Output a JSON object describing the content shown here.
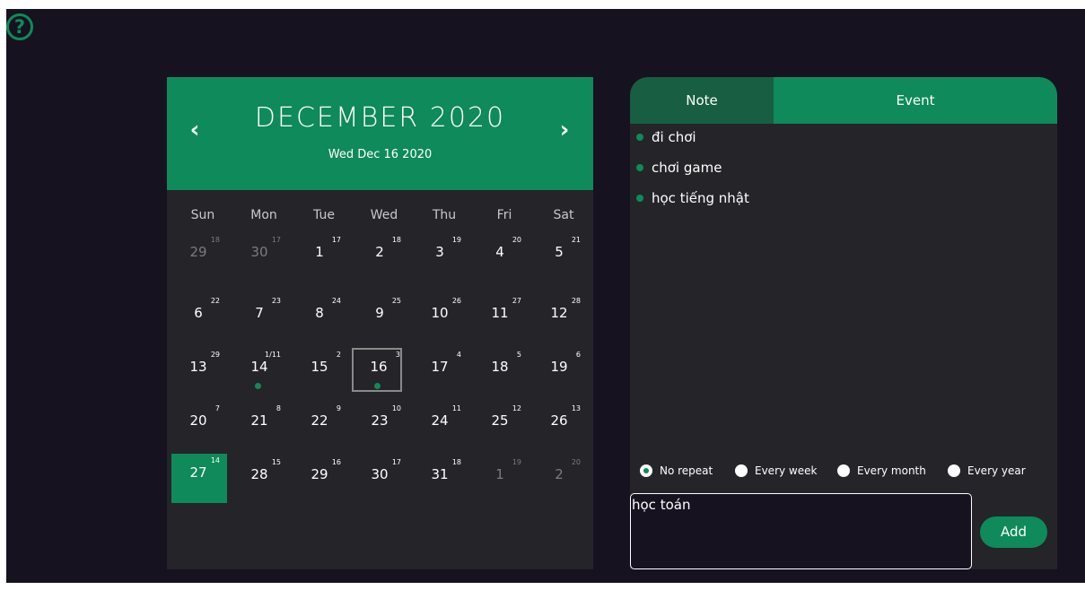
{
  "help": {
    "icon": "question-circle-icon",
    "glyph": "?"
  },
  "calendar": {
    "month_title": "DECEMBER 2020",
    "selected_date": "Wed Dec 16 2020",
    "prev_glyph": "‹",
    "next_glyph": "›",
    "weekdays": [
      "Sun",
      "Mon",
      "Tue",
      "Wed",
      "Thu",
      "Fri",
      "Sat"
    ],
    "weeks": [
      [
        {
          "d": "29",
          "l": "18",
          "m": true
        },
        {
          "d": "30",
          "l": "17",
          "m": true
        },
        {
          "d": "1",
          "l": "17"
        },
        {
          "d": "2",
          "l": "18"
        },
        {
          "d": "3",
          "l": "19"
        },
        {
          "d": "4",
          "l": "20"
        },
        {
          "d": "5",
          "l": "21"
        }
      ],
      [
        {
          "d": "6",
          "l": "22"
        },
        {
          "d": "7",
          "l": "23"
        },
        {
          "d": "8",
          "l": "24"
        },
        {
          "d": "9",
          "l": "25"
        },
        {
          "d": "10",
          "l": "26"
        },
        {
          "d": "11",
          "l": "27"
        },
        {
          "d": "12",
          "l": "28"
        }
      ],
      [
        {
          "d": "13",
          "l": "29"
        },
        {
          "d": "14",
          "l": "1/11",
          "dot": true
        },
        {
          "d": "15",
          "l": "2"
        },
        {
          "d": "16",
          "l": "3",
          "dot": true,
          "current": true
        },
        {
          "d": "17",
          "l": "4"
        },
        {
          "d": "18",
          "l": "5"
        },
        {
          "d": "19",
          "l": "6"
        }
      ],
      [
        {
          "d": "20",
          "l": "7"
        },
        {
          "d": "21",
          "l": "8"
        },
        {
          "d": "22",
          "l": "9"
        },
        {
          "d": "23",
          "l": "10"
        },
        {
          "d": "24",
          "l": "11"
        },
        {
          "d": "25",
          "l": "12"
        },
        {
          "d": "26",
          "l": "13"
        }
      ],
      [
        {
          "d": "27",
          "l": "14",
          "sel": true
        },
        {
          "d": "28",
          "l": "15"
        },
        {
          "d": "29",
          "l": "16"
        },
        {
          "d": "30",
          "l": "17"
        },
        {
          "d": "31",
          "l": "18"
        },
        {
          "d": "1",
          "l": "19",
          "m": true
        },
        {
          "d": "2",
          "l": "20",
          "m": true
        }
      ]
    ]
  },
  "panel": {
    "tabs": {
      "note": "Note",
      "event": "Event"
    },
    "events": [
      "đi chơi",
      "chơi game",
      "học tiếng nhật"
    ],
    "repeat_options": [
      "No repeat",
      "Every week",
      "Every month",
      "Every year"
    ],
    "repeat_selected": "No repeat",
    "input_value": "học toán",
    "add_label": "Add"
  },
  "colors": {
    "accent": "#0f8a5a",
    "background": "#161220",
    "panel": "#252429"
  }
}
